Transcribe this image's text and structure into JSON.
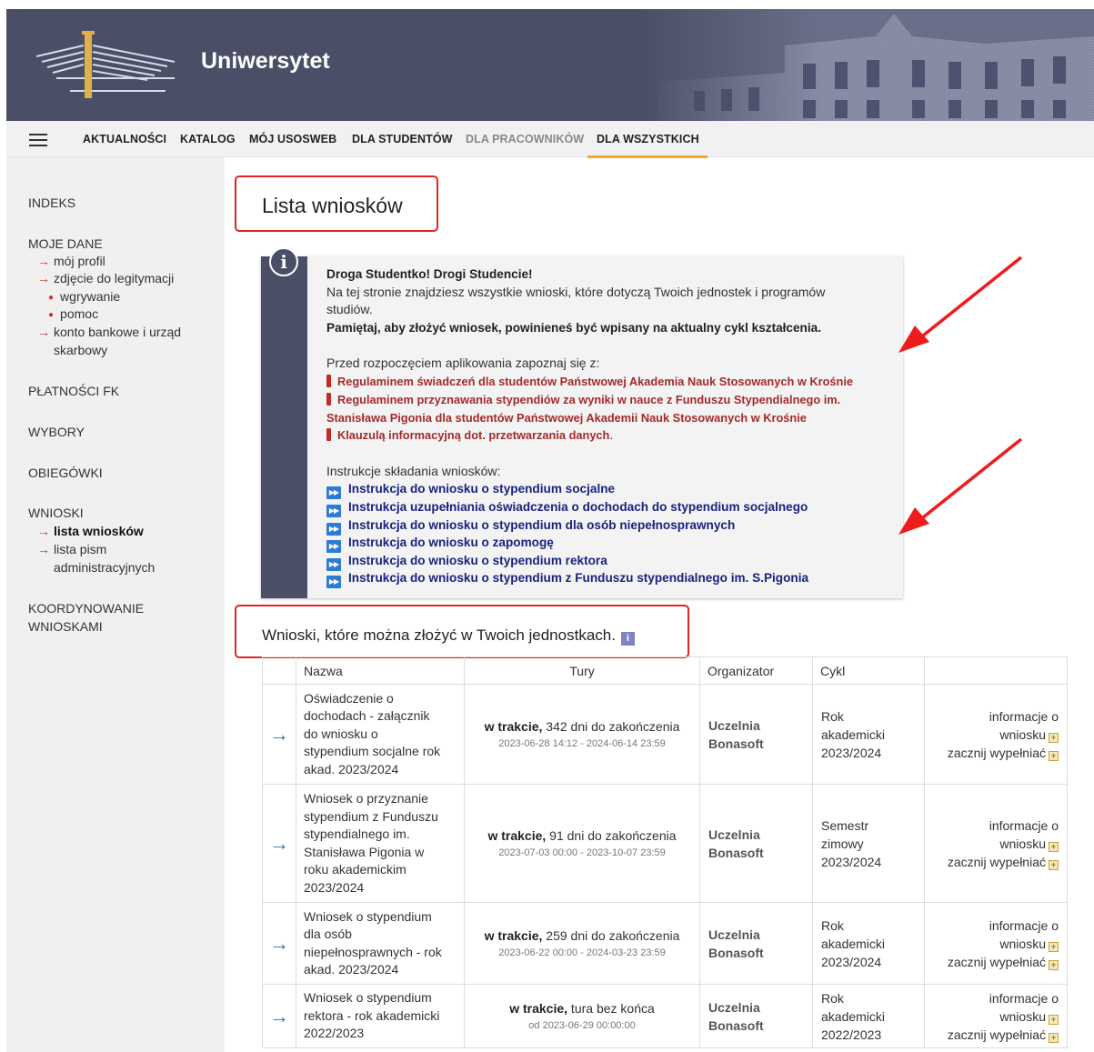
{
  "header": {
    "brand": "Uniwersytet"
  },
  "nav": {
    "items": [
      {
        "label": "AKTUALNOŚCI"
      },
      {
        "label": "KATALOG"
      },
      {
        "label": "MÓJ USOSWEB"
      },
      {
        "label": "DLA STUDENTÓW"
      },
      {
        "label": "DLA PRACOWNIKÓW"
      },
      {
        "label": "DLA WSZYSTKICH"
      }
    ],
    "active": "DLA WSZYSTKICH"
  },
  "sidebar": {
    "indeks": "INDEKS",
    "moje_dane": "MOJE DANE",
    "moj_profil": "mój profil",
    "zdjecie": "zdjęcie do legitymacji",
    "wgrywanie": "wgrywanie",
    "pomoc": "pomoc",
    "konto1": "konto bankowe i urząd",
    "konto2": "skarbowy",
    "platnosci": "PŁATNOŚCI FK",
    "wybory": "WYBORY",
    "obiegowki": "OBIEGÓWKI",
    "wnioski": "WNIOSKI",
    "lista_wnioskow": "lista wniosków",
    "lista_pism1": "lista pism",
    "lista_pism2": "administracyjnych",
    "koord1": "KOORDYNOWANIE",
    "koord2": "WNIOSKAMI"
  },
  "main": {
    "title": "Lista wniosków",
    "info": {
      "greeting": "Droga Studentko! Drogi Studencie!",
      "line1": "Na tej stronie znajdziesz wszystkie wnioski, które dotyczą Twoich jednostek i programów",
      "line2": "studiów.",
      "remember": "Pamiętaj, aby złożyć wniosek, powinieneś być wpisany na aktualny cykl kształcenia.",
      "before": "Przed rozpoczęciem aplikowania zapoznaj się z:",
      "reg1": "Regulaminem świadczeń dla studentów Państwowej Akademia Nauk Stosowanych w Krośnie",
      "reg2a": "Regulaminem przyznawania stypendiów za wyniki w nauce z Funduszu Stypendialnego im.",
      "reg2b": "Stanisława Pigonia dla studentów Państwowej Akademii Nauk Stosowanych w Krośnie",
      "reg3": "Klauzulą informacyjną dot. przetwarzania danych",
      "reg3_dot": ".",
      "instr_head": "Instrukcje składania wniosków:",
      "instr": [
        "Instrukcja do wniosku o stypendium socjalne",
        "Instrukcja uzupełniania oświadczenia o dochodach do stypendium socjalnego",
        "Instrukcja do wniosku o stypendium dla osób niepełnosprawnych",
        "Instrukcja do wniosku o zapomogę",
        "Instrukcja do wniosku o stypendium rektora",
        "Instrukcja do wniosku o stypendium z Funduszu stypendialnego im. S.Pigonia"
      ]
    },
    "section_title": "Wnioski, które można złożyć w Twoich jednostkach.",
    "table": {
      "headers": {
        "name": "Nazwa",
        "tury": "Tury",
        "org": "Organizator",
        "cykl": "Cykl"
      },
      "rows": [
        {
          "name": [
            "Oświadczenie o",
            "dochodach - załącznik",
            "do wniosku o",
            "stypendium socjalne rok",
            "akad. 2023/2024"
          ],
          "status": "w trakcie,",
          "rest": " 342 dni do zakończenia",
          "dates": "2023-06-28 14:12 - 2024-06-14 23:59",
          "org": [
            "Uczelnia",
            "Bonasoft"
          ],
          "cykl": [
            "Rok",
            "akademicki",
            "2023/2024"
          ],
          "info": [
            "informacje o",
            "wniosku"
          ],
          "fill": "zacznij wypełniać"
        },
        {
          "name": [
            "Wniosek o przyznanie",
            "stypendium z Funduszu",
            "stypendialnego im.",
            "Stanisława Pigonia w",
            "roku akademickim",
            "2023/2024"
          ],
          "status": "w trakcie,",
          "rest": " 91 dni do zakończenia",
          "dates": "2023-07-03 00:00 - 2023-10-07 23:59",
          "org": [
            "Uczelnia",
            "Bonasoft"
          ],
          "cykl": [
            "Semestr",
            "zimowy",
            "2023/2024"
          ],
          "info": [
            "informacje o",
            "wniosku"
          ],
          "fill": "zacznij wypełniać"
        },
        {
          "name": [
            "Wniosek o stypendium",
            "dla osób",
            "niepełnosprawnych - rok",
            "akad. 2023/2024"
          ],
          "status": "w trakcie,",
          "rest": " 259 dni do zakończenia",
          "dates": "2023-06-22 00:00 - 2024-03-23 23:59",
          "org": [
            "Uczelnia",
            "Bonasoft"
          ],
          "cykl": [
            "Rok",
            "akademicki",
            "2023/2024"
          ],
          "info": [
            "informacje o",
            "wniosku"
          ],
          "fill": "zacznij wypełniać"
        },
        {
          "name": [
            "Wniosek o stypendium",
            "rektora - rok akademicki",
            "2022/2023"
          ],
          "status": "w trakcie,",
          "rest": " tura bez końca",
          "dates": "od 2023-06-29 00:00:00",
          "org": [
            "Uczelnia",
            "Bonasoft"
          ],
          "cykl": [
            "Rok",
            "akademicki",
            "2022/2023"
          ],
          "info": [
            "informacje o",
            "wniosku"
          ],
          "fill": "zacznij wypełniać"
        }
      ]
    }
  },
  "icons": {
    "menu": "hamburger-icon",
    "info": "info-icon",
    "arrow": "arrow-right-icon",
    "plus": "plus-box-icon",
    "ff": "fast-forward-icon",
    "excl": "exclamation-icon"
  },
  "colors": {
    "header": "#4a4f67",
    "accent": "#f0a830",
    "highlight": "#e22424",
    "link_blue": "#1a237e",
    "link_red": "#a52a2a"
  }
}
